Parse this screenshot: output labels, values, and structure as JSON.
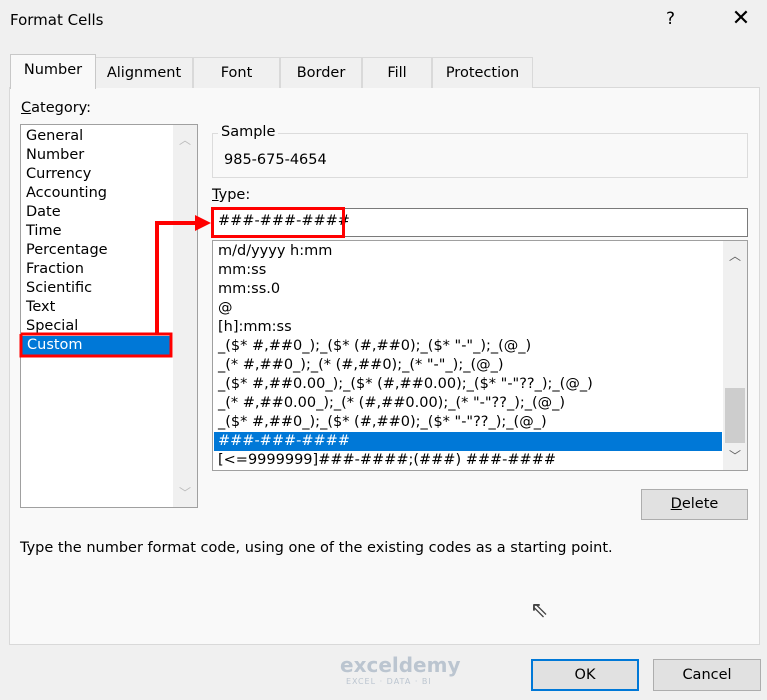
{
  "dialog": {
    "title": "Format Cells",
    "help": "?",
    "close": "✕"
  },
  "tabs": [
    {
      "label": "Number",
      "selected": true
    },
    {
      "label": "Alignment"
    },
    {
      "label": "Font"
    },
    {
      "label": "Border"
    },
    {
      "label": "Fill"
    },
    {
      "label": "Protection"
    }
  ],
  "category": {
    "label_prefix": "C",
    "label_rest": "ategory:",
    "items": [
      "General",
      "Number",
      "Currency",
      "Accounting",
      "Date",
      "Time",
      "Percentage",
      "Fraction",
      "Scientific",
      "Text",
      "Special",
      "Custom"
    ],
    "selected": "Custom"
  },
  "sample": {
    "label": "Sample",
    "value": "985-675-4654"
  },
  "type": {
    "label_prefix": "T",
    "label_rest": "ype:",
    "value": "###-###-####",
    "options": [
      "m/d/yyyy h:mm",
      "mm:ss",
      "mm:ss.0",
      "@",
      "[h]:mm:ss",
      "_($* #,##0_);_($* (#,##0);_($* \"-\"_);_(@_)",
      "_(* #,##0_);_(* (#,##0);_(* \"-\"_);_(@_)",
      "_($* #,##0.00_);_($* (#,##0.00);_($* \"-\"??_);_(@_)",
      "_(* #,##0.00_);_(* (#,##0.00);_(* \"-\"??_);_(@_)",
      "_($* #,##0_);_($* (#,##0);_($* \"-\"??_);_(@_)",
      "###-###-####",
      "[<=9999999]###-####;(###) ###-####"
    ],
    "selected": "###-###-####"
  },
  "delete": {
    "prefix": "D",
    "rest": "elete"
  },
  "description": "Type the number format code, using one of the existing codes as a starting point.",
  "ok": "OK",
  "cancel": "Cancel",
  "watermark": {
    "name": "exceldemy",
    "tagline": "EXCEL · DATA · BI"
  },
  "colors": {
    "accent": "#0078d7",
    "highlight": "#ff0000"
  }
}
